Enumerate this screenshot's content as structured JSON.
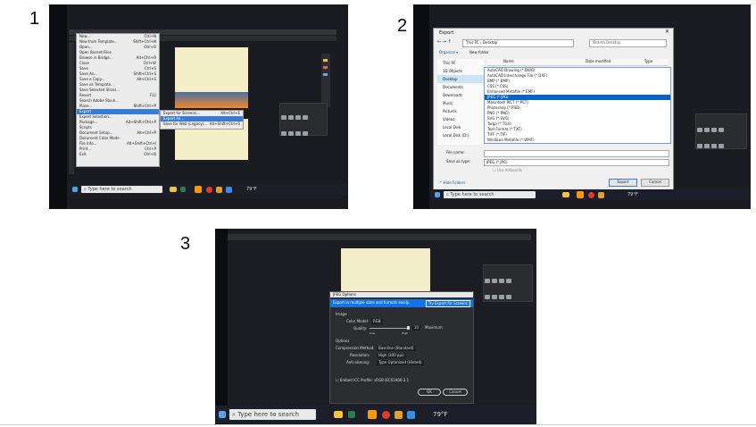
{
  "steps": {
    "one": "1",
    "two": "2",
    "three": "3"
  },
  "shot1": {
    "menu_items": [
      {
        "label": "New...",
        "shortcut": "Ctrl+N"
      },
      {
        "label": "New from Template...",
        "shortcut": "Shift+Ctrl+N"
      },
      {
        "label": "Open...",
        "shortcut": "Ctrl+O"
      },
      {
        "label": "Open Recent Files",
        "shortcut": ""
      },
      {
        "label": "Browse in Bridge...",
        "shortcut": "Alt+Ctrl+O"
      },
      {
        "label": "Close",
        "shortcut": "Ctrl+W"
      },
      {
        "label": "Save",
        "shortcut": "Ctrl+S"
      },
      {
        "label": "Save As...",
        "shortcut": "Shift+Ctrl+S"
      },
      {
        "label": "Save a Copy...",
        "shortcut": "Alt+Ctrl+S"
      },
      {
        "label": "Save as Template...",
        "shortcut": ""
      },
      {
        "label": "Save Selected Slices...",
        "shortcut": ""
      },
      {
        "label": "Revert",
        "shortcut": "F12"
      },
      {
        "label": "Search Adobe Stock...",
        "shortcut": ""
      },
      {
        "label": "Place...",
        "shortcut": "Shift+Ctrl+P"
      },
      {
        "label": "Export",
        "shortcut": ""
      },
      {
        "label": "Export Selection...",
        "shortcut": ""
      },
      {
        "label": "Package...",
        "shortcut": "Alt+Shift+Ctrl+P"
      },
      {
        "label": "Scripts",
        "shortcut": ""
      },
      {
        "label": "Document Setup...",
        "shortcut": "Alt+Ctrl+P"
      },
      {
        "label": "Document Color Mode",
        "shortcut": ""
      },
      {
        "label": "File Info...",
        "shortcut": "Alt+Shift+Ctrl+I"
      },
      {
        "label": "Print...",
        "shortcut": "Ctrl+P"
      },
      {
        "label": "Exit",
        "shortcut": "Ctrl+Q"
      }
    ],
    "export_submenu": [
      {
        "label": "Export for Screens...",
        "shortcut": "Alt+Ctrl+E"
      },
      {
        "label": "Export As...",
        "shortcut": ""
      },
      {
        "label": "Save for Web (Legacy)...",
        "shortcut": "Alt+Shift+Ctrl+S"
      }
    ],
    "search_placeholder": "Type here to search",
    "temperature": "79°F"
  },
  "shot2": {
    "title": "Export",
    "breadcrumb": "This PC  ›  Desktop",
    "search_placeholder": "Search Desktop",
    "organize": "Organize ▾",
    "new_folder": "New folder",
    "col_name": "Name",
    "col_modified": "Date modified",
    "col_type": "Type",
    "nav_items": [
      "This PC",
      "3D Objects",
      "Desktop",
      "Documents",
      "Downloads",
      "Music",
      "Pictures",
      "Videos",
      "Local Disk",
      "Local Disk (D:)"
    ],
    "file_types": [
      "AutoCAD Drawing (*.DWG)",
      "AutoCAD Interchange File (*.DXF)",
      "BMP (*.BMP)",
      "CSS (*.CSS)",
      "Enhanced Metafile (*.EMF)",
      "JPEG (*.JPG)",
      "Macintosh PICT (*.PCT)",
      "Photoshop (*.PSD)",
      "PNG (*.PNG)",
      "SVG (*.SVG)",
      "Targa (*.TGA)",
      "Text Format (*.TXT)",
      "TIFF (*.TIF)",
      "Windows Metafile (*.WMF)"
    ],
    "selected_type": "JPEG (*.JPG)",
    "file_name_label": "File name:",
    "save_type_label": "Save as type:",
    "save_type_value": "JPEG (*.JPG)",
    "use_artboards": "Use Artboards",
    "hide_folders": "Hide Folders",
    "export_btn": "Export",
    "cancel_btn": "Cancel",
    "search_placeholder_task": "Type here to search",
    "temperature": "79°F"
  },
  "shot3": {
    "dialog_title": "JPEG Options",
    "banner_text": "Export in multiple sizes and formats easily.",
    "banner_button": "Try Export for Screens",
    "image_label": "Image",
    "color_model_label": "Color Model:",
    "color_model_value": "RGB",
    "quality_label": "Quality:",
    "quality_value": "10",
    "quality_preset": "Maximum",
    "quality_low": "Low",
    "quality_high": "High",
    "quality_smaller": "Smaller file",
    "quality_larger": "Larger file",
    "options_label": "Options",
    "compression_label": "Compression Method:",
    "compression_value": "Baseline (Standard)",
    "resolution_label": "Resolution:",
    "resolution_value": "High (300 ppi)",
    "antialias_label": "Anti-aliasing:",
    "antialias_value": "Type Optimized (Hinted)",
    "icc_label": "Embed ICC Profile:",
    "icc_value": "sRGB IEC61966-2.1",
    "ok": "OK",
    "cancel": "Cancel",
    "search_placeholder": "Type here to search",
    "temperature": "79°F"
  }
}
